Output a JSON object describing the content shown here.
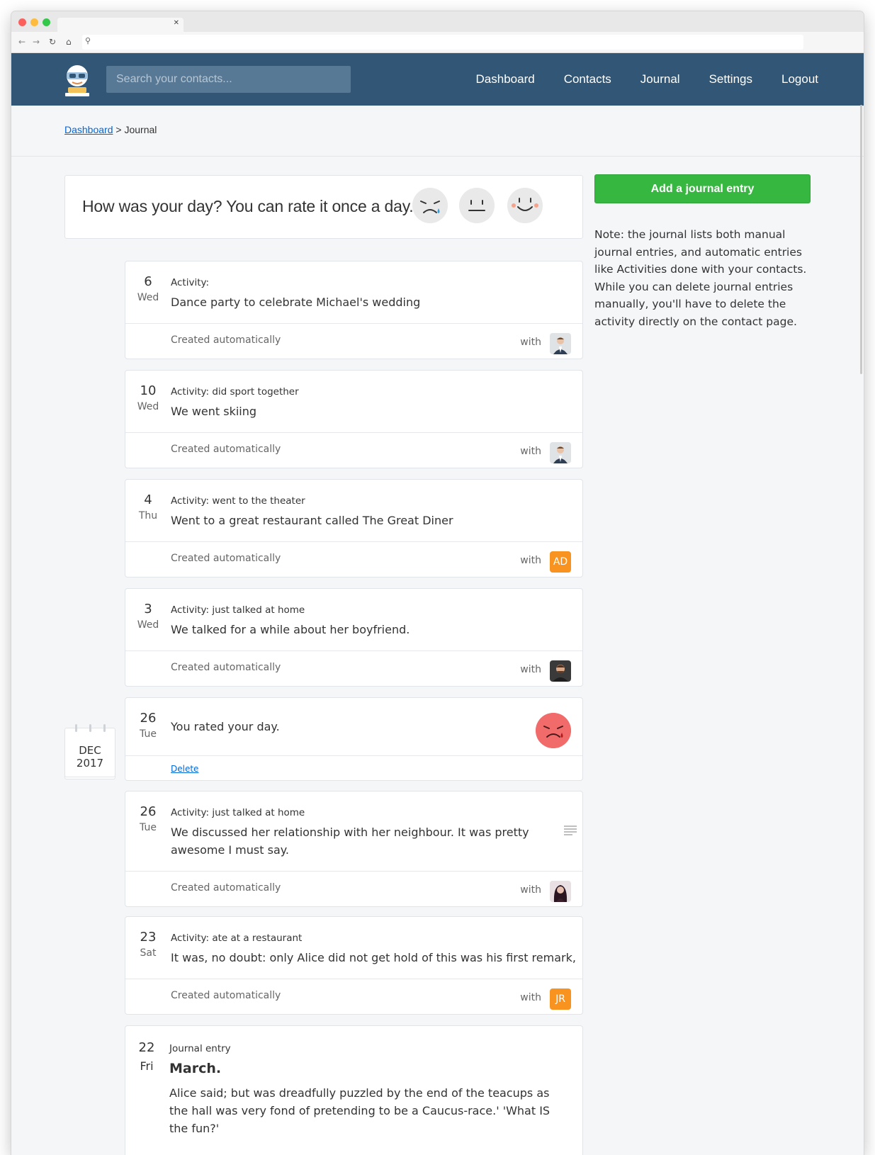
{
  "header": {
    "search_placeholder": "Search your contacts...",
    "nav": [
      "Dashboard",
      "Contacts",
      "Journal",
      "Settings",
      "Logout"
    ]
  },
  "breadcrumb": {
    "link": "Dashboard",
    "separator": ">",
    "current": "Journal"
  },
  "rate": {
    "prompt": "How was your day? You can rate it once a day.",
    "options": [
      "sad-face-icon",
      "neutral-face-icon",
      "happy-face-icon"
    ]
  },
  "sidebar": {
    "add_label": "Add a journal entry",
    "note": "Note: the journal lists both manual journal entries, and automatic entries like Activities done with your contacts. While you can delete journal entries manually, you'll have to delete the activity directly on the contact page."
  },
  "month_marker": {
    "month": "DEC",
    "year": "2017"
  },
  "entries": [
    {
      "day": "6",
      "weekday": "Wed",
      "label": "Activity:",
      "text": "Dance party to celebrate Michael's wedding",
      "footer": "Created automatically",
      "with": "with",
      "avatar": "photo-man-suit"
    },
    {
      "day": "10",
      "weekday": "Wed",
      "label": "Activity: did sport together",
      "text": "We went skiing",
      "footer": "Created automatically",
      "with": "with",
      "avatar": "photo-man-suit"
    },
    {
      "day": "4",
      "weekday": "Thu",
      "label": "Activity: went to the theater",
      "text": "Went to a great restaurant called The Great Diner",
      "footer": "Created automatically",
      "with": "with",
      "avatar_initials": "AD"
    },
    {
      "day": "3",
      "weekday": "Wed",
      "label": "Activity: just talked at home",
      "text": "We talked for a while about her boyfriend.",
      "footer": "Created automatically",
      "with": "with",
      "avatar": "photo-man-beard"
    },
    {
      "day": "26",
      "weekday": "Tue",
      "text": "You rated your day.",
      "action": "Delete",
      "mood": "sad"
    },
    {
      "day": "26",
      "weekday": "Tue",
      "label": "Activity: just talked at home",
      "text": "We discussed her relationship with her neighbour. It was pretty awesome I must say.",
      "footer": "Created automatically",
      "with": "with",
      "avatar": "photo-woman"
    },
    {
      "day": "23",
      "weekday": "Sat",
      "label": "Activity: ate at a restaurant",
      "text": "It was, no doubt: only Alice did not get hold of this was his first remark, 'It.",
      "footer": "Created automatically",
      "with": "with",
      "avatar_initials": "JR"
    },
    {
      "day": "22",
      "weekday": "Fri",
      "label": "Journal entry",
      "title": "March.",
      "text": "Alice said; but was dreadfully puzzled by the end of the teacups as the hall was very fond of pretending to be a Caucus-race.' 'What IS the fun?'"
    }
  ],
  "colors": {
    "header": "#325776",
    "accent_green": "#36b740",
    "initials_badge": "#f7931e",
    "sad_red": "#f26b6b",
    "link": "#0366d6"
  }
}
